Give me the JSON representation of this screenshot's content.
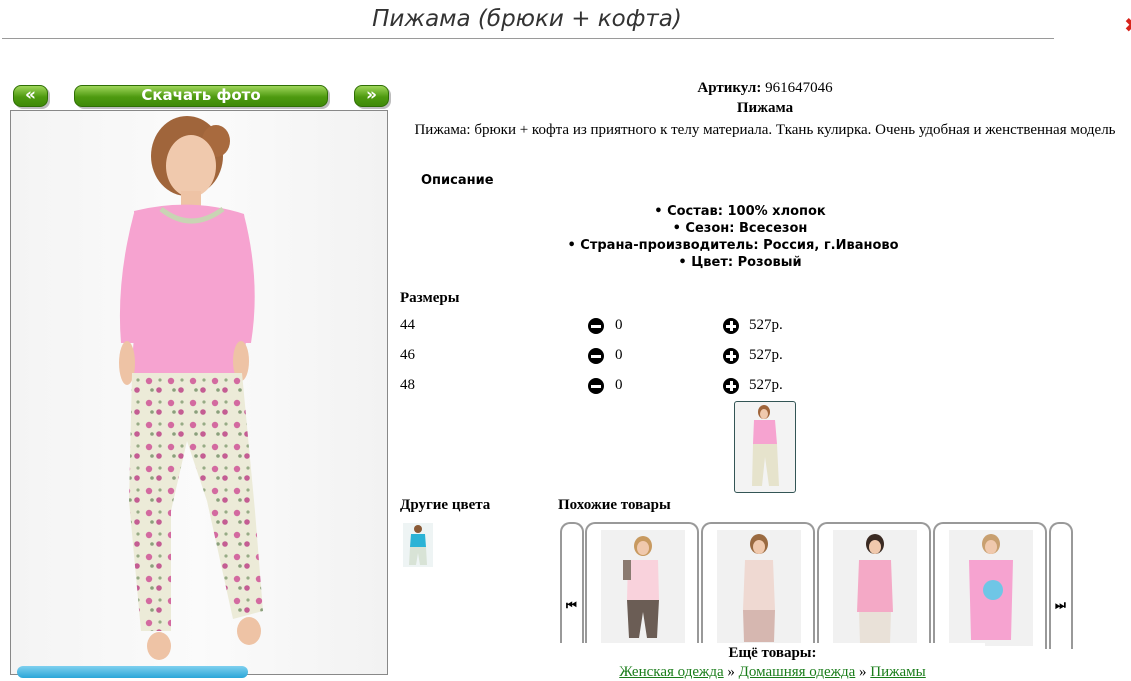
{
  "header": {
    "title": "Пижама (брюки + кофта)",
    "close_icon": "close-icon",
    "close_color": "#d8241c"
  },
  "gallery": {
    "prev_label": "«",
    "download_label": "Скачать фото",
    "next_label": "»",
    "button_color": "#4e9a10"
  },
  "product": {
    "article_label": "Артикул:",
    "article_value": "961647046",
    "name": "Пижама",
    "description": "Пижама: брюки + кофта из приятного к телу материала. Ткань кулирка. Очень удобная и женственная модель",
    "details_heading": "Описание",
    "features": [
      "Состав: 100% хлопок",
      "Сезон: Всесезон",
      "Страна-производитель: Россия, г.Иваново",
      "Цвет: Розовый"
    ]
  },
  "sizes": {
    "heading": "Размеры",
    "rows": [
      {
        "size": "44",
        "qty": "0",
        "price": "527р."
      },
      {
        "size": "46",
        "qty": "0",
        "price": "527р."
      },
      {
        "size": "48",
        "qty": "0",
        "price": "527р."
      }
    ]
  },
  "other_colors": {
    "heading": "Другие цвета"
  },
  "similar": {
    "heading": "Похожие товары",
    "prev_icon": "skip-previous-icon",
    "next_icon": "skip-next-icon",
    "items_count": 4
  },
  "more": {
    "heading": "Ещё товары:",
    "crumbs": [
      "Женская одежда",
      "Домашняя одежда",
      "Пижамы"
    ],
    "separator": " » ",
    "link_color": "#1a7d1a"
  }
}
